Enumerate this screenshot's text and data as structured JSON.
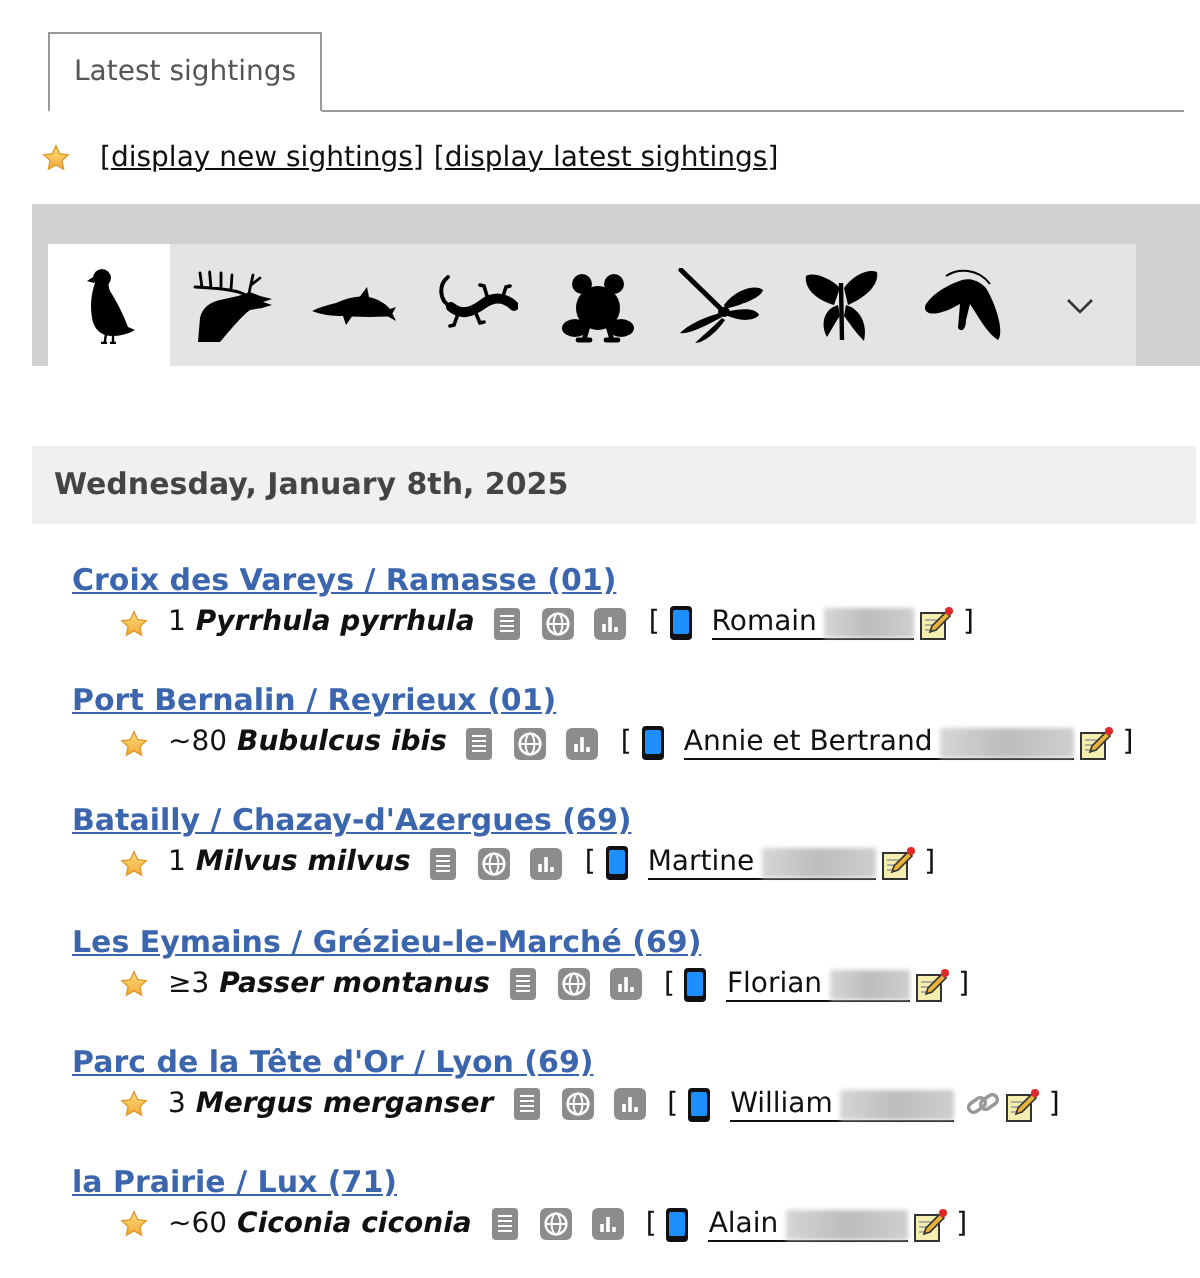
{
  "tabs": [
    {
      "label": "Latest sightings",
      "selected": true
    }
  ],
  "links": [
    {
      "open": "[",
      "label": "display new sightings",
      "close": "]"
    },
    {
      "open": "[",
      "label": "display latest sightings",
      "close": "]"
    }
  ],
  "categories": [
    {
      "kind": "bird",
      "selected": true
    },
    {
      "kind": "deer",
      "selected": false
    },
    {
      "kind": "dolphin",
      "selected": false
    },
    {
      "kind": "lizard",
      "selected": false
    },
    {
      "kind": "frog",
      "selected": false
    },
    {
      "kind": "dragonfly",
      "selected": false
    },
    {
      "kind": "butterfly",
      "selected": false
    },
    {
      "kind": "moth",
      "selected": false
    }
  ],
  "days": [
    {
      "date": "Wednesday, January 8th, 2025",
      "sightings": [
        {
          "location": "Croix des Vareys / Ramasse (01)",
          "count": "1",
          "species": "Pyrrhula pyrrhula",
          "open": "[",
          "observer": "Romain",
          "linked": false,
          "close": "]"
        },
        {
          "location": "Port Bernalin / Reyrieux (01)",
          "count": "~80",
          "species": "Bubulcus ibis",
          "open": "[",
          "observer": "Annie et Bertrand",
          "linked": false,
          "close": "]"
        },
        {
          "location": "Batailly / Chazay-d'Azergues (69)",
          "count": "1",
          "species": "Milvus milvus",
          "open": "[",
          "observer": "Martine",
          "linked": false,
          "close": "]"
        },
        {
          "location": "Les Eymains / Grézieu-le-Marché (69)",
          "count": "≥3",
          "species": "Passer montanus",
          "open": "[",
          "observer": "Florian",
          "linked": false,
          "close": "]"
        },
        {
          "location": "Parc de la Tête d'Or / Lyon (69)",
          "count": "3",
          "species": "Mergus merganser",
          "open": "[",
          "observer": "William",
          "linked": true,
          "close": "]"
        },
        {
          "location": "la Prairie / Lux (71)",
          "count": "~60",
          "species": "Ciconia ciconia",
          "open": "[",
          "observer": "Alain",
          "linked": false,
          "close": "]"
        }
      ]
    }
  ]
}
